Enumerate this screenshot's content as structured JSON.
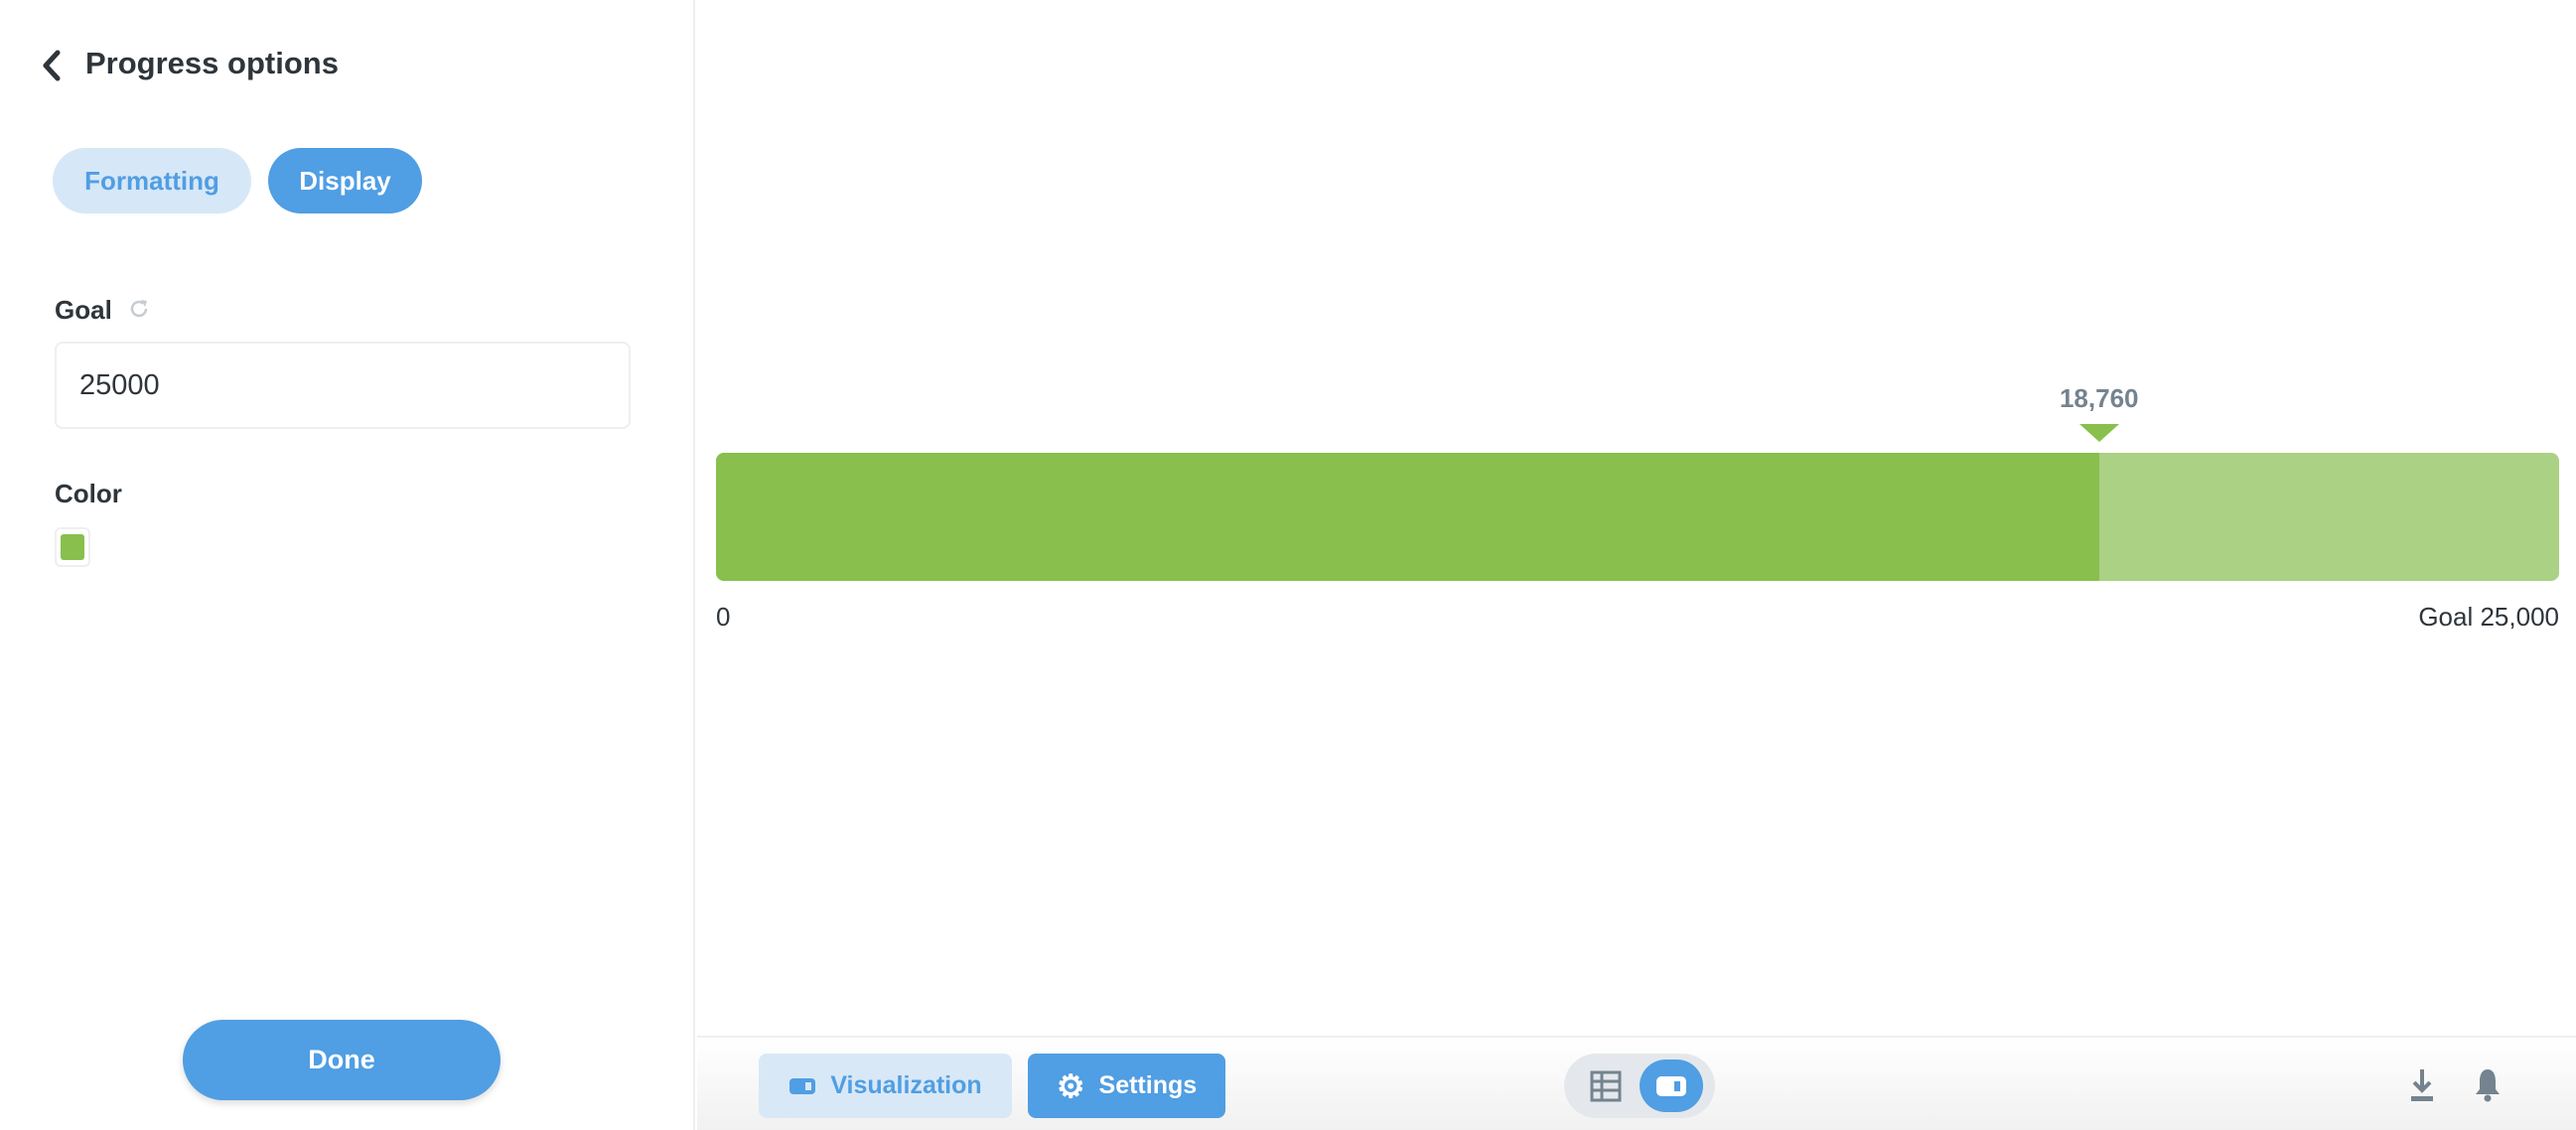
{
  "sidebar": {
    "title": "Progress options",
    "tabs": [
      {
        "label": "Formatting",
        "active": false
      },
      {
        "label": "Display",
        "active": true
      }
    ],
    "goal_label": "Goal",
    "goal_value": "25000",
    "color_label": "Color",
    "color_value": "#88bf4d",
    "done_label": "Done"
  },
  "chart_data": {
    "type": "progress",
    "value": 18760,
    "value_label": "18,760",
    "goal": 25000,
    "min_label": "0",
    "goal_label": "Goal 25,000",
    "colors": {
      "fill": "#88bf4d",
      "remaining": "#abd184",
      "value_text": "#74838f"
    }
  },
  "footer": {
    "visualization_label": "Visualization",
    "settings_label": "Settings",
    "icons": [
      "table-icon",
      "chart-icon",
      "download-icon",
      "bell-icon"
    ],
    "accent": "#509ee3"
  }
}
